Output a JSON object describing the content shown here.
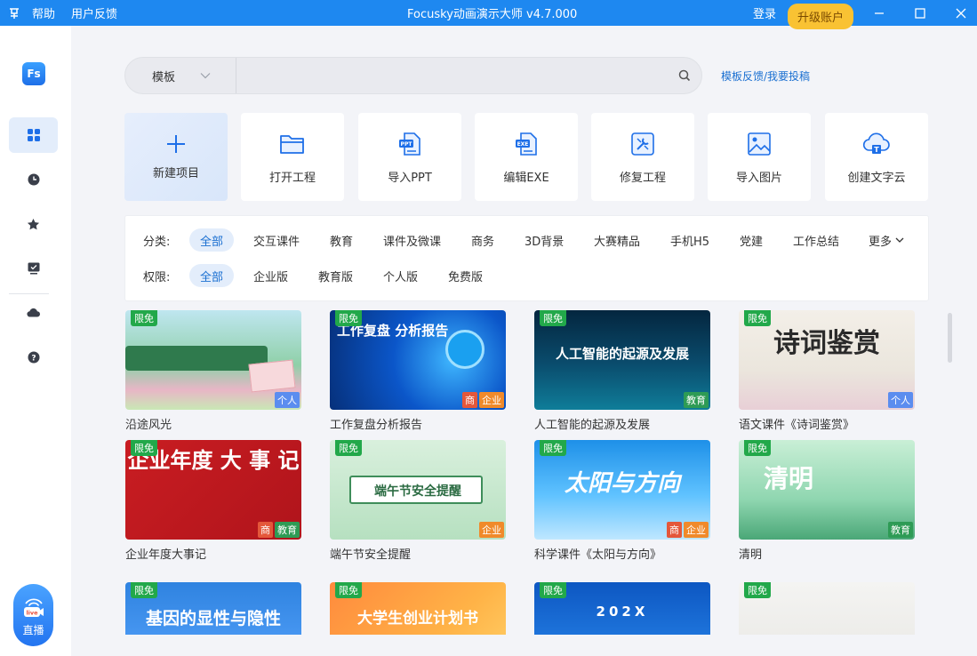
{
  "titlebar": {
    "help": "帮助",
    "feedback": "用户反馈",
    "title": "Focusky动画演示大师 v4.7.000",
    "login": "登录",
    "upgrade": "升级账户"
  },
  "sidebar": {
    "logo": "Fs",
    "live": "直播",
    "live_badge": "live"
  },
  "search": {
    "category": "模板",
    "placeholder": "",
    "value": "",
    "template_feedback": "模板反馈/我要投稿"
  },
  "actions": [
    "新建项目",
    "打开工程",
    "导入PPT",
    "编辑EXE",
    "修复工程",
    "导入图片",
    "创建文字云"
  ],
  "filters": {
    "category_label": "分类:",
    "categories": [
      "全部",
      "交互课件",
      "教育",
      "课件及微课",
      "商务",
      "3D背景",
      "大赛精品",
      "手机H5",
      "党建",
      "工作总结",
      "更多"
    ],
    "permission_label": "权限:",
    "permissions": [
      "全部",
      "企业版",
      "教育版",
      "个人版",
      "免费版"
    ]
  },
  "templates": [
    {
      "caption": "沿途风光",
      "limit": "限免",
      "thumb_text": "",
      "tags": [
        "个人"
      ]
    },
    {
      "caption": "工作复盘分析报告",
      "limit": "限免",
      "thumb_text": "工作复盘 分析报告",
      "tags": [
        "商",
        "企业"
      ]
    },
    {
      "caption": "人工智能的起源及发展",
      "limit": "限免",
      "thumb_text": "人工智能的起源及发展",
      "tags": [
        "教育"
      ]
    },
    {
      "caption": "语文课件《诗词鉴赏》",
      "limit": "限免",
      "thumb_text": "诗词鉴赏",
      "tags": [
        "个人"
      ]
    },
    {
      "caption": "企业年度大事记",
      "limit": "限免",
      "thumb_text": "企业年度 大 事 记",
      "tags": [
        "商",
        "教育"
      ]
    },
    {
      "caption": "端午节安全提醒",
      "limit": "限免",
      "thumb_text": "端午节安全提醒",
      "tags": [
        "企业"
      ]
    },
    {
      "caption": "科学课件《太阳与方向》",
      "limit": "限免",
      "thumb_text": "太阳与方向",
      "tags": [
        "商",
        "企业"
      ]
    },
    {
      "caption": "清明",
      "limit": "限免",
      "thumb_text": "清明",
      "tags": [
        "教育"
      ]
    },
    {
      "caption": "",
      "limit": "限免",
      "thumb_text": "基因的显性与隐性",
      "tags": []
    },
    {
      "caption": "",
      "limit": "限免",
      "thumb_text": "大学生创业计划书",
      "tags": []
    },
    {
      "caption": "",
      "limit": "限免",
      "thumb_text": "202X",
      "tags": []
    },
    {
      "caption": "",
      "limit": "限免",
      "thumb_text": "",
      "tags": []
    }
  ],
  "colors": {
    "accent": "#1e88f0",
    "upgrade": "#f9c233",
    "limit_badge": "#22a84a"
  }
}
